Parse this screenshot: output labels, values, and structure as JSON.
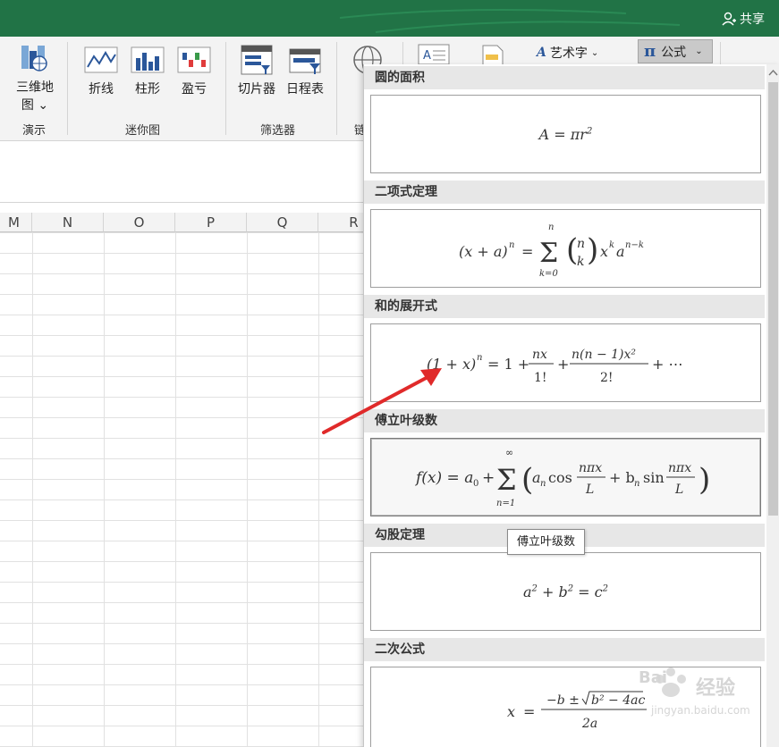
{
  "titlebar": {
    "share_label": "共享"
  },
  "ribbon": {
    "buttons": {
      "map3d_line1": "三维地",
      "map3d_line2": "图",
      "line": "折线",
      "column": "柱形",
      "winloss": "盈亏",
      "slicer": "切片器",
      "timeline": "日程表",
      "link_partial": "链"
    },
    "groups": {
      "tour": "演示",
      "sparklines": "迷你图",
      "filters": "筛选器"
    },
    "wordart": "艺术字",
    "formula": "公式"
  },
  "grid": {
    "columns": [
      "M",
      "N",
      "O",
      "P",
      "Q",
      "R"
    ]
  },
  "gallery": {
    "sections": [
      {
        "title": "圆的面积",
        "formula": "A = πr²"
      },
      {
        "title": "二项式定理",
        "formula": "(x + a)ⁿ = Σ (n k) xᵏaⁿ⁻ᵏ"
      },
      {
        "title": "和的展开式",
        "formula": "(1 + x)ⁿ = 1 + nx/1! + n(n − 1)x²/2! + ⋯"
      },
      {
        "title": "傅立叶级数",
        "formula": "f(x) = a₀ + Σ (aₙ cos nπx/L + bₙ sin nπx/L)"
      },
      {
        "title": "勾股定理",
        "formula": "a² + b² = c²"
      },
      {
        "title": "二次公式",
        "formula": "x = (−b ± √(b² − 4ac))/2a"
      }
    ],
    "tooltip": "傅立叶级数"
  },
  "watermark": {
    "text1": "Bai",
    "text2": "经验",
    "text3": "jingyan.baidu.com"
  },
  "colors": {
    "title_bar": "#217346",
    "arrow": "#e02a2a",
    "formula_btn_bg": "#c9c9c9"
  }
}
